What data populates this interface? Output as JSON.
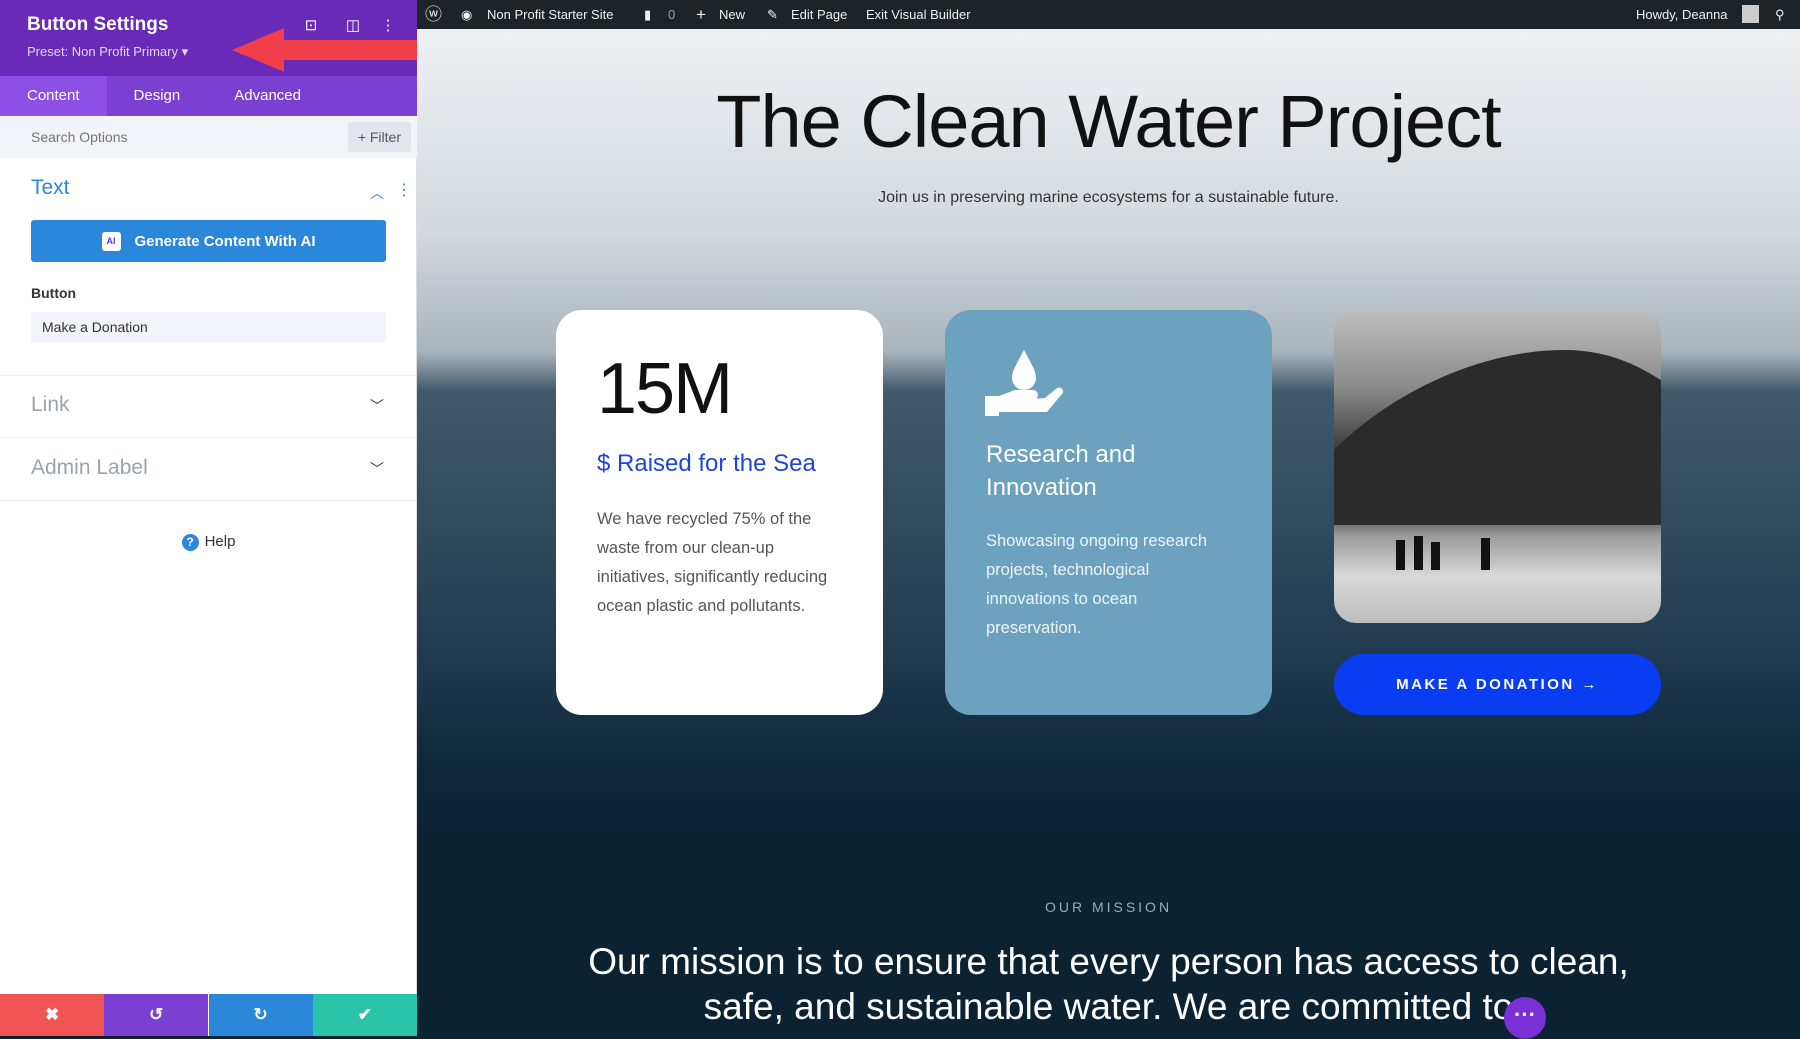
{
  "panel": {
    "title": "Button Settings",
    "preset": "Preset: Non Profit Primary ▾",
    "tabs": [
      {
        "label": "Content"
      },
      {
        "label": "Design"
      },
      {
        "label": "Advanced"
      }
    ],
    "search_placeholder": "Search Options",
    "filter_label": "+ Filter",
    "text_section": {
      "title": "Text",
      "generate_label": "Generate Content With AI",
      "ai_badge": "AI",
      "field_label": "Button",
      "field_value": "Make a Donation"
    },
    "link_section": "Link",
    "admin_label_section": "Admin Label",
    "help": "Help",
    "footer_icons": [
      "close-icon",
      "undo-icon",
      "redo-icon",
      "check-icon"
    ],
    "annotation_arrow_color": "#f03e4a"
  },
  "adminbar": {
    "site": "Non Profit Starter Site",
    "comments": "0",
    "new": "New",
    "edit": "Edit Page",
    "exit": "Exit Visual Builder",
    "howdy": "Howdy, Deanna"
  },
  "page": {
    "title": "The Clean Water Project",
    "subtitle": "Join us in preserving marine ecosystems for a sustainable future.",
    "card1": {
      "stat": "15M",
      "heading": "$ Raised for the Sea",
      "body": "We have recycled 75% of the waste from our clean-up initiatives, significantly reducing ocean plastic and pollutants."
    },
    "card2": {
      "icon": "water-drop-hand-icon",
      "heading": "Research and Innovation",
      "body": "Showcasing ongoing research projects, technological innovations to ocean preservation."
    },
    "donate": "MAKE A DONATION →",
    "eyebrow": "OUR MISSION",
    "mission": "Our mission is to ensure that every person has access to clean, safe, and sustainable water. We are committed to"
  },
  "colors": {
    "purple": "#6a2ab8",
    "accent_blue": "#2b87da",
    "donate_blue": "#0a3cf2"
  }
}
